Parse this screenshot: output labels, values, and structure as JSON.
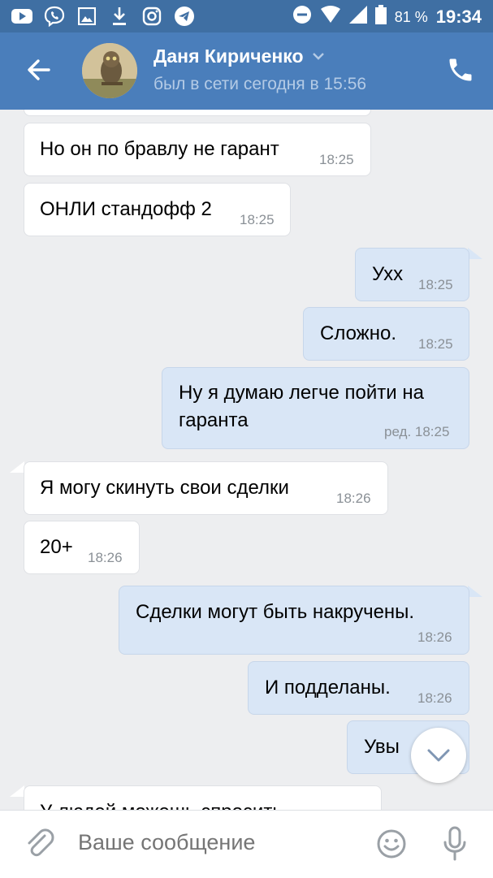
{
  "statusbar": {
    "battery_percent": "81 %",
    "time": "19:34",
    "icons": [
      "youtube-icon",
      "viber-icon",
      "gallery-icon",
      "download-icon",
      "instagram-icon",
      "telegram-icon",
      "do-not-disturb-icon",
      "wifi-icon",
      "signal-icon",
      "battery-icon"
    ]
  },
  "header": {
    "contact_name": "Даня Кириченко",
    "last_seen": "был в сети сегодня в 15:56"
  },
  "messages": [
    {
      "dir": "in",
      "text": "Но он по бравлу не гарант",
      "time": "18:25"
    },
    {
      "dir": "in",
      "text": "ОНЛИ стандофф 2",
      "time": "18:25"
    },
    {
      "dir": "out",
      "text": "Ухх",
      "time": "18:25"
    },
    {
      "dir": "out",
      "text": "Сложно.",
      "time": "18:25"
    },
    {
      "dir": "out",
      "text": "Ну я думаю легче пойти на гаранта",
      "time": "ред. 18:25"
    },
    {
      "dir": "in",
      "text": "Я могу скинуть свои сделки",
      "time": "18:26"
    },
    {
      "dir": "in",
      "text": "20+",
      "time": "18:26"
    },
    {
      "dir": "out",
      "text": "Сделки могут быть накручены.",
      "time": "18:26"
    },
    {
      "dir": "out",
      "text": "И подделаны.",
      "time": "18:26"
    },
    {
      "dir": "out",
      "text": "Увы",
      "time": ""
    },
    {
      "dir": "in",
      "text": "У людей можешь спросить",
      "time": ""
    }
  ],
  "composer": {
    "placeholder": "Ваше сообщение"
  },
  "colors": {
    "header_bg": "#4a7ebb",
    "statusbar_bg": "#3f6fa3",
    "incoming_bubble": "#ffffff",
    "outgoing_bubble": "#d9e6f6",
    "chat_bg": "#edeef0"
  }
}
